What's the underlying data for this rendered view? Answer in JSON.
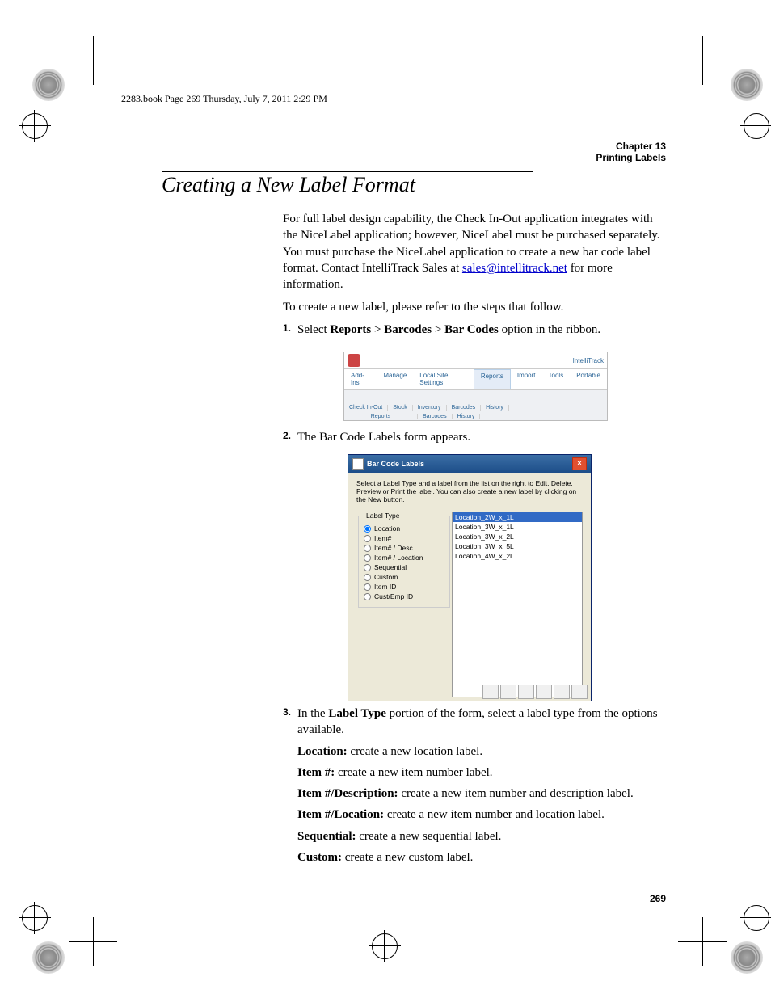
{
  "header_line": "2283.book  Page 269  Thursday, July 7, 2011  2:29 PM",
  "chapter": {
    "line1": "Chapter 13",
    "line2": "Printing Labels"
  },
  "title": "Creating a New Label Format",
  "para1_a": "For full label design capability, the Check In-Out application integrates with the NiceLabel application; however, NiceLabel must be purchased separately. You must purchase the NiceLabel application to create a new bar code label format. Contact IntelliTrack Sales at ",
  "para1_link": "sales@intellitrack.net",
  "para1_b": " for more information.",
  "para2": "To create a new label, please refer to the steps that follow.",
  "step1_a": "Select ",
  "step1_b1": "Reports",
  "step1_gt1": " > ",
  "step1_b2": "Barcodes",
  "step1_gt2": " > ",
  "step1_b3": "Bar Codes",
  "step1_c": " option in the ribbon.",
  "step2": "The Bar Code Labels form appears.",
  "step3_a": "In the ",
  "step3_b": "Label Type",
  "step3_c": " portion of the form, select a label type from the options available.",
  "desc": {
    "loc_b": "Location:",
    "loc_t": " create a new location label.",
    "itm_b": "Item #:",
    "itm_t": " create a new item number label.",
    "itd_b": "Item #/Description:",
    "itd_t": " create a new item number and description label.",
    "itl_b": "Item #/Location:",
    "itl_t": " create a new item number and location label.",
    "seq_b": "Sequential:",
    "seq_t": " create a new sequential label.",
    "cus_b": "Custom:",
    "cus_t": " create a new custom label."
  },
  "page_num": "269",
  "fig1": {
    "brand": "IntelliTrack",
    "tabs": [
      "Add-Ins",
      "Manage",
      "Local Site Settings",
      "Reports",
      "Import",
      "Tools",
      "Portable"
    ],
    "groups_top": [
      "Check In-Out",
      "Stock",
      "Inventory",
      "Barcodes",
      "History"
    ],
    "groups_bot": [
      "Reports",
      "Barcodes",
      "History"
    ]
  },
  "fig2": {
    "title": "Bar Code Labels",
    "instr": "Select a Label Type and a label from the list on the right to Edit, Delete, Preview or Print the label. You can also create a new label by clicking on the New button.",
    "legend": "Label Type",
    "radios": [
      "Location",
      "Item#",
      "Item# / Desc",
      "Item# / Location",
      "Sequential",
      "Custom",
      "Item ID",
      "Cust/Emp ID"
    ],
    "list": [
      "Location_2W_x_1L",
      "Location_3W_x_1L",
      "Location_3W_x_2L",
      "Location_3W_x_5L",
      "Location_4W_x_2L"
    ]
  }
}
